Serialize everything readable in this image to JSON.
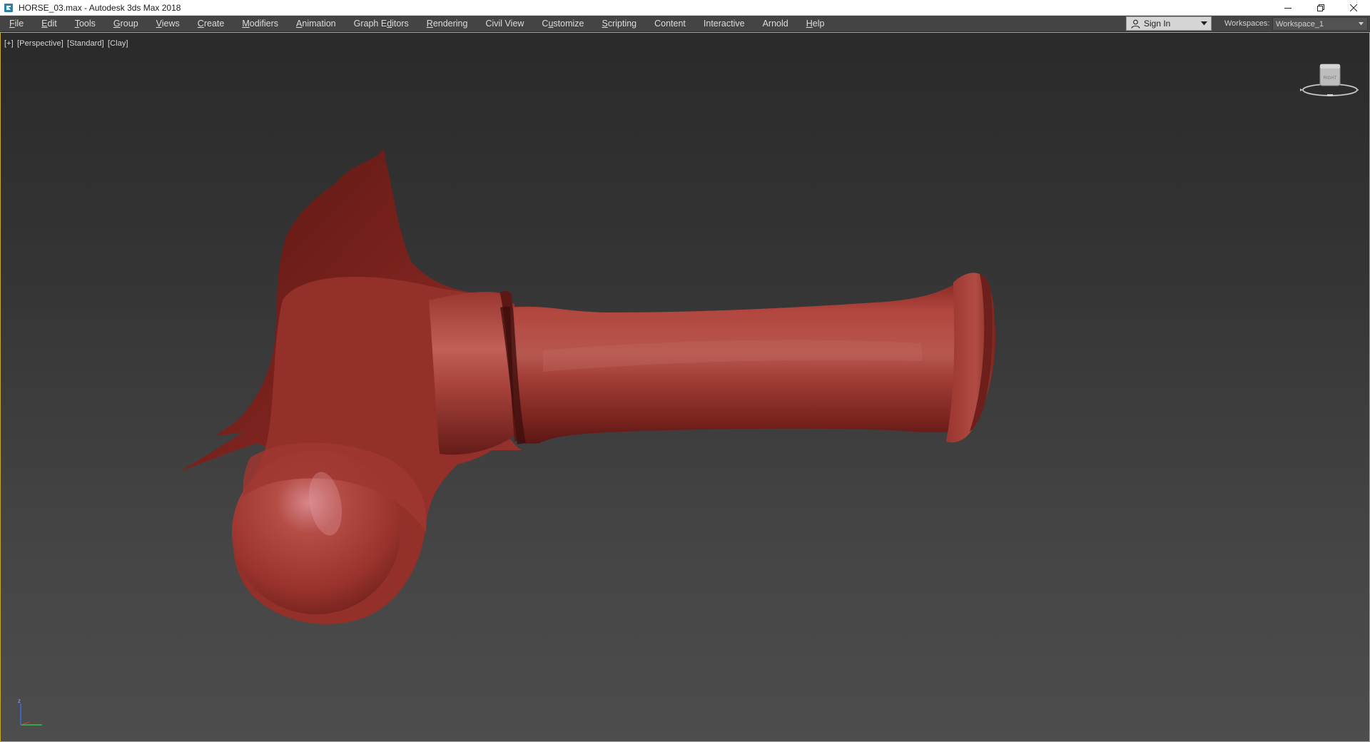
{
  "window": {
    "title": "HORSE_03.max - Autodesk 3ds Max 2018"
  },
  "menu": {
    "items": [
      {
        "pre": "",
        "u": "F",
        "post": "ile"
      },
      {
        "pre": "",
        "u": "E",
        "post": "dit"
      },
      {
        "pre": "",
        "u": "T",
        "post": "ools"
      },
      {
        "pre": "",
        "u": "G",
        "post": "roup"
      },
      {
        "pre": "",
        "u": "V",
        "post": "iews"
      },
      {
        "pre": "",
        "u": "C",
        "post": "reate"
      },
      {
        "pre": "",
        "u": "M",
        "post": "odifiers"
      },
      {
        "pre": "",
        "u": "A",
        "post": "nimation"
      },
      {
        "pre": "Graph E",
        "u": "d",
        "post": "itors"
      },
      {
        "pre": "",
        "u": "R",
        "post": "endering"
      },
      {
        "pre": "Civil View",
        "u": "",
        "post": ""
      },
      {
        "pre": "C",
        "u": "u",
        "post": "stomize"
      },
      {
        "pre": "",
        "u": "S",
        "post": "cripting"
      },
      {
        "pre": "Content",
        "u": "",
        "post": ""
      },
      {
        "pre": "Interactive",
        "u": "",
        "post": ""
      },
      {
        "pre": "Arnold",
        "u": "",
        "post": ""
      },
      {
        "pre": "",
        "u": "H",
        "post": "elp"
      }
    ]
  },
  "account": {
    "sign_in_label": "Sign In"
  },
  "workspaces": {
    "label": "Workspaces:",
    "value": "Workspace_1"
  },
  "viewport": {
    "labels": [
      "[+]",
      "[Perspective]",
      "[Standard]",
      "[Clay]"
    ],
    "viewcube_face": "RIGHT",
    "axis_z": "z",
    "model_color": "#a83a33",
    "border_color": "#c8a82e"
  }
}
